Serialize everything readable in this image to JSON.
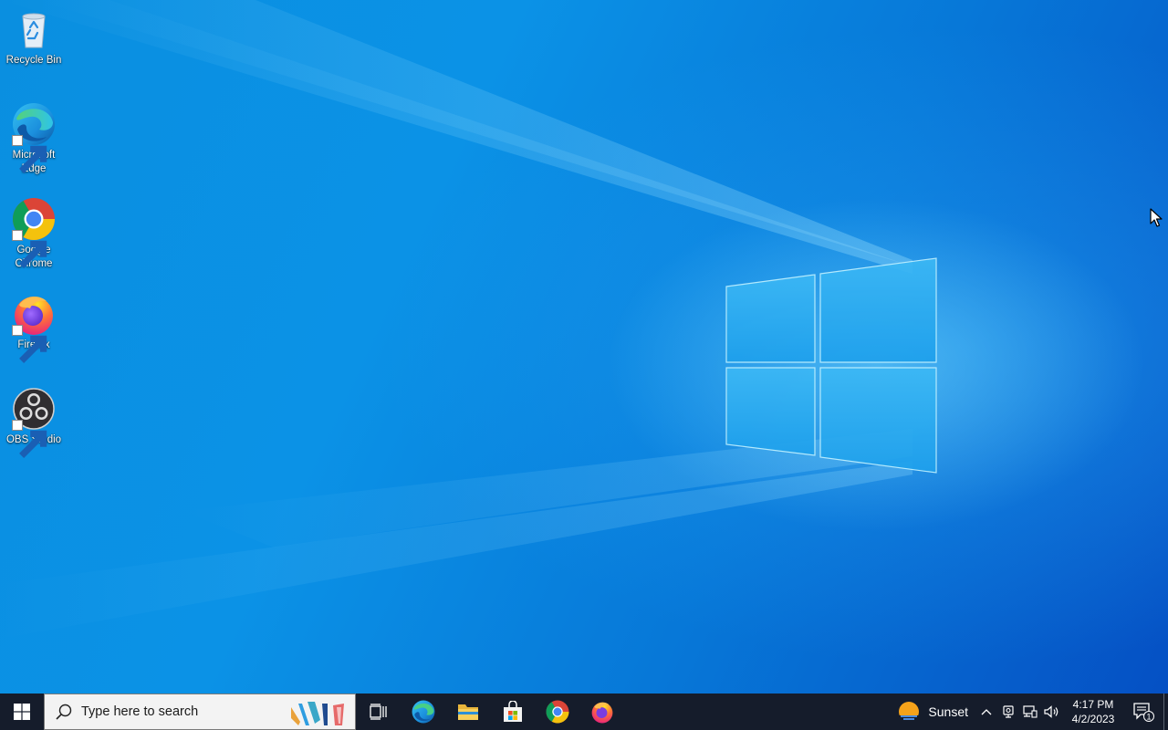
{
  "desktop": {
    "icons": [
      {
        "label": "Recycle Bin",
        "icon": "recycle-bin-icon",
        "shortcut": false
      },
      {
        "label": "Microsoft Edge",
        "icon": "edge-icon",
        "shortcut": true
      },
      {
        "label": "Google Chrome",
        "icon": "chrome-icon",
        "shortcut": true
      },
      {
        "label": "Firefox",
        "icon": "firefox-icon",
        "shortcut": true
      },
      {
        "label": "OBS Studio",
        "icon": "obs-icon",
        "shortcut": true
      }
    ]
  },
  "taskbar": {
    "search_placeholder": "Type here to search",
    "pinned": [
      "task-view-icon",
      "edge-icon",
      "file-explorer-icon",
      "microsoft-store-icon",
      "chrome-icon",
      "firefox-icon"
    ],
    "weather_label": "Sunset",
    "time": "4:17 PM",
    "date": "4/2/2023",
    "notification_count": "1"
  },
  "colors": {
    "taskbar_bg": "#151c2b",
    "wallpaper_accent": "#0a8fe0"
  }
}
